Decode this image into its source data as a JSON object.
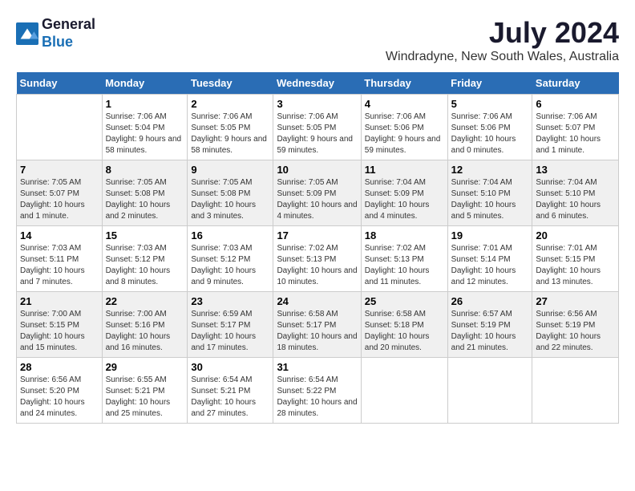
{
  "logo": {
    "line1": "General",
    "line2": "Blue"
  },
  "title": "July 2024",
  "subtitle": "Windradyne, New South Wales, Australia",
  "days_header": [
    "Sunday",
    "Monday",
    "Tuesday",
    "Wednesday",
    "Thursday",
    "Friday",
    "Saturday"
  ],
  "weeks": [
    [
      {
        "num": "",
        "sunrise": "",
        "sunset": "",
        "daylight": ""
      },
      {
        "num": "1",
        "sunrise": "Sunrise: 7:06 AM",
        "sunset": "Sunset: 5:04 PM",
        "daylight": "Daylight: 9 hours and 58 minutes."
      },
      {
        "num": "2",
        "sunrise": "Sunrise: 7:06 AM",
        "sunset": "Sunset: 5:05 PM",
        "daylight": "Daylight: 9 hours and 58 minutes."
      },
      {
        "num": "3",
        "sunrise": "Sunrise: 7:06 AM",
        "sunset": "Sunset: 5:05 PM",
        "daylight": "Daylight: 9 hours and 59 minutes."
      },
      {
        "num": "4",
        "sunrise": "Sunrise: 7:06 AM",
        "sunset": "Sunset: 5:06 PM",
        "daylight": "Daylight: 9 hours and 59 minutes."
      },
      {
        "num": "5",
        "sunrise": "Sunrise: 7:06 AM",
        "sunset": "Sunset: 5:06 PM",
        "daylight": "Daylight: 10 hours and 0 minutes."
      },
      {
        "num": "6",
        "sunrise": "Sunrise: 7:06 AM",
        "sunset": "Sunset: 5:07 PM",
        "daylight": "Daylight: 10 hours and 1 minute."
      }
    ],
    [
      {
        "num": "7",
        "sunrise": "Sunrise: 7:05 AM",
        "sunset": "Sunset: 5:07 PM",
        "daylight": "Daylight: 10 hours and 1 minute."
      },
      {
        "num": "8",
        "sunrise": "Sunrise: 7:05 AM",
        "sunset": "Sunset: 5:08 PM",
        "daylight": "Daylight: 10 hours and 2 minutes."
      },
      {
        "num": "9",
        "sunrise": "Sunrise: 7:05 AM",
        "sunset": "Sunset: 5:08 PM",
        "daylight": "Daylight: 10 hours and 3 minutes."
      },
      {
        "num": "10",
        "sunrise": "Sunrise: 7:05 AM",
        "sunset": "Sunset: 5:09 PM",
        "daylight": "Daylight: 10 hours and 4 minutes."
      },
      {
        "num": "11",
        "sunrise": "Sunrise: 7:04 AM",
        "sunset": "Sunset: 5:09 PM",
        "daylight": "Daylight: 10 hours and 4 minutes."
      },
      {
        "num": "12",
        "sunrise": "Sunrise: 7:04 AM",
        "sunset": "Sunset: 5:10 PM",
        "daylight": "Daylight: 10 hours and 5 minutes."
      },
      {
        "num": "13",
        "sunrise": "Sunrise: 7:04 AM",
        "sunset": "Sunset: 5:10 PM",
        "daylight": "Daylight: 10 hours and 6 minutes."
      }
    ],
    [
      {
        "num": "14",
        "sunrise": "Sunrise: 7:03 AM",
        "sunset": "Sunset: 5:11 PM",
        "daylight": "Daylight: 10 hours and 7 minutes."
      },
      {
        "num": "15",
        "sunrise": "Sunrise: 7:03 AM",
        "sunset": "Sunset: 5:12 PM",
        "daylight": "Daylight: 10 hours and 8 minutes."
      },
      {
        "num": "16",
        "sunrise": "Sunrise: 7:03 AM",
        "sunset": "Sunset: 5:12 PM",
        "daylight": "Daylight: 10 hours and 9 minutes."
      },
      {
        "num": "17",
        "sunrise": "Sunrise: 7:02 AM",
        "sunset": "Sunset: 5:13 PM",
        "daylight": "Daylight: 10 hours and 10 minutes."
      },
      {
        "num": "18",
        "sunrise": "Sunrise: 7:02 AM",
        "sunset": "Sunset: 5:13 PM",
        "daylight": "Daylight: 10 hours and 11 minutes."
      },
      {
        "num": "19",
        "sunrise": "Sunrise: 7:01 AM",
        "sunset": "Sunset: 5:14 PM",
        "daylight": "Daylight: 10 hours and 12 minutes."
      },
      {
        "num": "20",
        "sunrise": "Sunrise: 7:01 AM",
        "sunset": "Sunset: 5:15 PM",
        "daylight": "Daylight: 10 hours and 13 minutes."
      }
    ],
    [
      {
        "num": "21",
        "sunrise": "Sunrise: 7:00 AM",
        "sunset": "Sunset: 5:15 PM",
        "daylight": "Daylight: 10 hours and 15 minutes."
      },
      {
        "num": "22",
        "sunrise": "Sunrise: 7:00 AM",
        "sunset": "Sunset: 5:16 PM",
        "daylight": "Daylight: 10 hours and 16 minutes."
      },
      {
        "num": "23",
        "sunrise": "Sunrise: 6:59 AM",
        "sunset": "Sunset: 5:17 PM",
        "daylight": "Daylight: 10 hours and 17 minutes."
      },
      {
        "num": "24",
        "sunrise": "Sunrise: 6:58 AM",
        "sunset": "Sunset: 5:17 PM",
        "daylight": "Daylight: 10 hours and 18 minutes."
      },
      {
        "num": "25",
        "sunrise": "Sunrise: 6:58 AM",
        "sunset": "Sunset: 5:18 PM",
        "daylight": "Daylight: 10 hours and 20 minutes."
      },
      {
        "num": "26",
        "sunrise": "Sunrise: 6:57 AM",
        "sunset": "Sunset: 5:19 PM",
        "daylight": "Daylight: 10 hours and 21 minutes."
      },
      {
        "num": "27",
        "sunrise": "Sunrise: 6:56 AM",
        "sunset": "Sunset: 5:19 PM",
        "daylight": "Daylight: 10 hours and 22 minutes."
      }
    ],
    [
      {
        "num": "28",
        "sunrise": "Sunrise: 6:56 AM",
        "sunset": "Sunset: 5:20 PM",
        "daylight": "Daylight: 10 hours and 24 minutes."
      },
      {
        "num": "29",
        "sunrise": "Sunrise: 6:55 AM",
        "sunset": "Sunset: 5:21 PM",
        "daylight": "Daylight: 10 hours and 25 minutes."
      },
      {
        "num": "30",
        "sunrise": "Sunrise: 6:54 AM",
        "sunset": "Sunset: 5:21 PM",
        "daylight": "Daylight: 10 hours and 27 minutes."
      },
      {
        "num": "31",
        "sunrise": "Sunrise: 6:54 AM",
        "sunset": "Sunset: 5:22 PM",
        "daylight": "Daylight: 10 hours and 28 minutes."
      },
      {
        "num": "",
        "sunrise": "",
        "sunset": "",
        "daylight": ""
      },
      {
        "num": "",
        "sunrise": "",
        "sunset": "",
        "daylight": ""
      },
      {
        "num": "",
        "sunrise": "",
        "sunset": "",
        "daylight": ""
      }
    ]
  ]
}
